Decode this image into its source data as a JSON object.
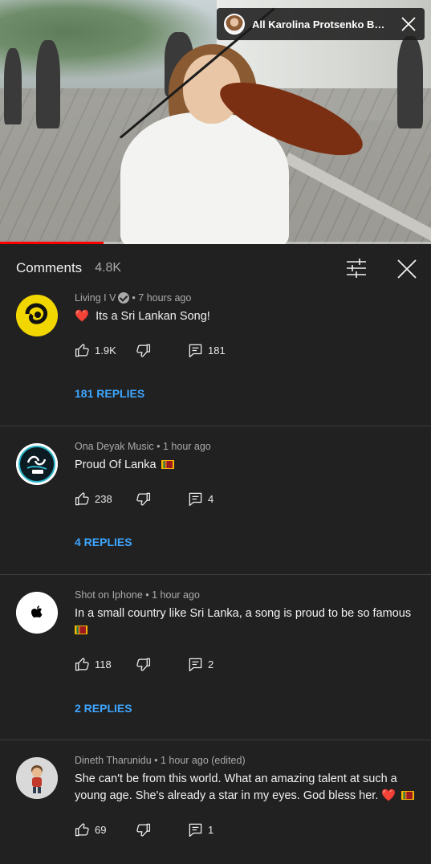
{
  "video": {
    "channel_pill_title": "All Karolina Protsenko Buski...",
    "progress_fraction": 0.24
  },
  "header": {
    "title": "Comments",
    "count": "4.8K"
  },
  "comments": [
    {
      "author": "Living I V",
      "verified": true,
      "time": "7 hours ago",
      "text": "Its a Sri Lankan Song!",
      "likes": "1.9K",
      "reply_count": "181",
      "replies_link": "181 REPLIES"
    },
    {
      "author": "Ona Deyak Music",
      "verified": false,
      "time": "1 hour ago",
      "text": "Proud Of Lanka",
      "likes": "238",
      "reply_count": "4",
      "replies_link": "4 REPLIES"
    },
    {
      "author": "Shot on Iphone",
      "verified": false,
      "time": "1 hour ago",
      "text": "In a small country like Sri Lanka, a song is proud to be so famous",
      "likes": "118",
      "reply_count": "2",
      "replies_link": "2 REPLIES"
    },
    {
      "author": "Dineth Tharunidu",
      "verified": false,
      "time": "1 hour ago (edited)",
      "text": "She can't be from this world. What an amazing talent at such a young age. She's already a star in my eyes. God bless her.",
      "likes": "69",
      "reply_count": "1"
    }
  ],
  "colors": {
    "background": "#212121",
    "accent_link": "#3ea6ff",
    "progress": "#ff0000"
  },
  "icons": [
    "close-icon",
    "filter-icon",
    "like-icon",
    "dislike-icon",
    "reply-icon",
    "more-vert-icon",
    "verified-icon",
    "heart-emoji",
    "sri-lanka-flag-emoji"
  ]
}
